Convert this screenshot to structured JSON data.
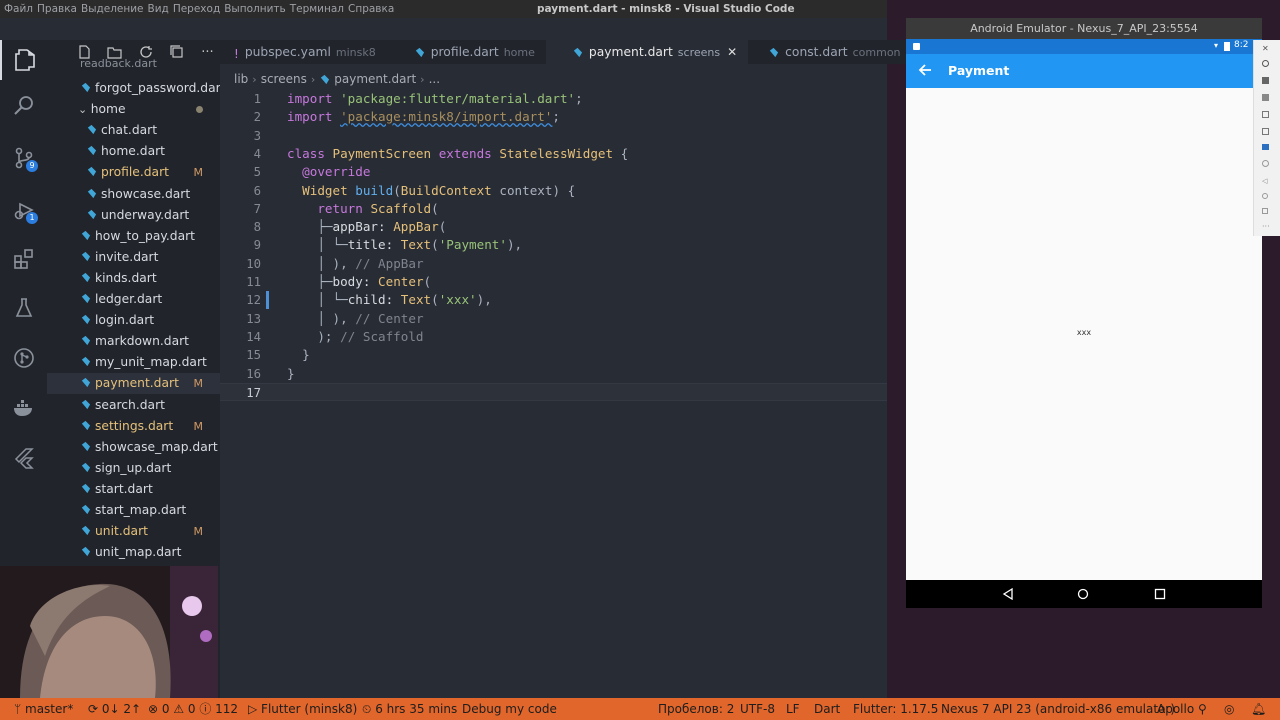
{
  "window": {
    "menu": [
      "Файл",
      "Правка",
      "Выделение",
      "Вид",
      "Переход",
      "Выполнить",
      "Терминал",
      "Справка"
    ],
    "title": "payment.dart - minsk8 - Visual Studio Code"
  },
  "activity_bar": {
    "scm_badge": "9",
    "debug_badge": "1"
  },
  "explorer": {
    "partial_top": "readback.dart",
    "items": [
      {
        "label": "forgot_password.dart",
        "indent": 0,
        "modified": ""
      },
      {
        "label": "home",
        "indent": 0,
        "folder": true,
        "modified": ""
      },
      {
        "label": "chat.dart",
        "indent": 1,
        "modified": ""
      },
      {
        "label": "home.dart",
        "indent": 1,
        "modified": ""
      },
      {
        "label": "profile.dart",
        "indent": 1,
        "modified": "M"
      },
      {
        "label": "showcase.dart",
        "indent": 1,
        "modified": ""
      },
      {
        "label": "underway.dart",
        "indent": 1,
        "modified": ""
      },
      {
        "label": "how_to_pay.dart",
        "indent": 0,
        "modified": ""
      },
      {
        "label": "invite.dart",
        "indent": 0,
        "modified": ""
      },
      {
        "label": "kinds.dart",
        "indent": 0,
        "modified": ""
      },
      {
        "label": "ledger.dart",
        "indent": 0,
        "modified": ""
      },
      {
        "label": "login.dart",
        "indent": 0,
        "modified": ""
      },
      {
        "label": "markdown.dart",
        "indent": 0,
        "modified": ""
      },
      {
        "label": "my_unit_map.dart",
        "indent": 0,
        "modified": ""
      },
      {
        "label": "payment.dart",
        "indent": 0,
        "modified": "M",
        "selected": true
      },
      {
        "label": "search.dart",
        "indent": 0,
        "modified": ""
      },
      {
        "label": "settings.dart",
        "indent": 0,
        "modified": "M"
      },
      {
        "label": "showcase_map.dart",
        "indent": 0,
        "modified": ""
      },
      {
        "label": "sign_up.dart",
        "indent": 0,
        "modified": ""
      },
      {
        "label": "start.dart",
        "indent": 0,
        "modified": ""
      },
      {
        "label": "start_map.dart",
        "indent": 0,
        "modified": ""
      },
      {
        "label": "unit.dart",
        "indent": 0,
        "modified": "M"
      },
      {
        "label": "unit_map.dart",
        "indent": 0,
        "modified": ""
      }
    ]
  },
  "tabs": [
    {
      "name": "pubspec.yaml",
      "desc": "minsk8",
      "icon": "yaml-icon"
    },
    {
      "name": "profile.dart",
      "desc": "home",
      "icon": "dart-icon"
    },
    {
      "name": "payment.dart",
      "desc": "screens",
      "icon": "dart-icon",
      "active": true
    },
    {
      "name": "const.dart",
      "desc": "common",
      "icon": "dart-icon"
    }
  ],
  "breadcrumb": [
    "lib",
    "screens",
    "payment.dart",
    "..."
  ],
  "code_lines": [
    "1",
    "2",
    "3",
    "4",
    "5",
    "6",
    "7",
    "8",
    "9",
    "10",
    "11",
    "12",
    "13",
    "14",
    "15",
    "16",
    "17"
  ],
  "code": {
    "l1_kw": "import",
    "l1_str": "'package:flutter/material.dart'",
    "l1_end": ";",
    "l2_kw": "import",
    "l2_str": "'package:minsk8/import.dart'",
    "l2_end": ";",
    "l4_kw1": "class",
    "l4_cls": "PaymentScreen",
    "l4_kw2": "extends",
    "l4_cls2": "StatelessWidget",
    "l4_end": " {",
    "l5": "@override",
    "l6_cls": "Widget",
    "l6_fn": "build",
    "l6_p": "(",
    "l6_cls2": "BuildContext",
    "l6_end": " context) {",
    "l7_kw": "return",
    "l7_cls": "Scaffold",
    "l7_end": "(",
    "l8_prop": "appBar:",
    "l8_cls": "AppBar",
    "l8_end": "(",
    "l9_prop": "title:",
    "l9_cls": "Text",
    "l9_p": "(",
    "l9_str": "'Payment'",
    "l9_end": "),",
    "l10": "),",
    "l10_cm": "// AppBar",
    "l11_prop": "body:",
    "l11_cls": "Center",
    "l11_end": "(",
    "l12_prop": "child:",
    "l12_cls": "Text",
    "l12_p": "(",
    "l12_str": "'xxx'",
    "l12_end": "),",
    "l13": "),",
    "l13_cm": "// Center",
    "l14": ");",
    "l14_cm": "// Scaffold",
    "l15": "}",
    "l16": "}"
  },
  "statusbar": {
    "branch": "master*",
    "sync": "0↓ 2↑",
    "problems": "⊗ 0 ⚠ 0 ⓘ 112",
    "launch": "Flutter (minsk8)",
    "time": "6 hrs 35 mins",
    "debug": "Debug my code",
    "spaces": "Пробелов: 2",
    "encoding": "UTF-8",
    "eol": "LF",
    "lang": "Dart",
    "flutter": "Flutter: 1.17.5",
    "device": "Nexus 7 API 23 (android-x86 emulator)",
    "apollo": "Apollo"
  },
  "emulator": {
    "title": "Android Emulator - Nexus_7_API_23:5554",
    "clock": "8:2",
    "appbar_title": "Payment",
    "body_text": "xxx"
  },
  "colors": {
    "accent": "#e0662b",
    "editor_bg": "#282c34",
    "appbar": "#2196f3"
  }
}
